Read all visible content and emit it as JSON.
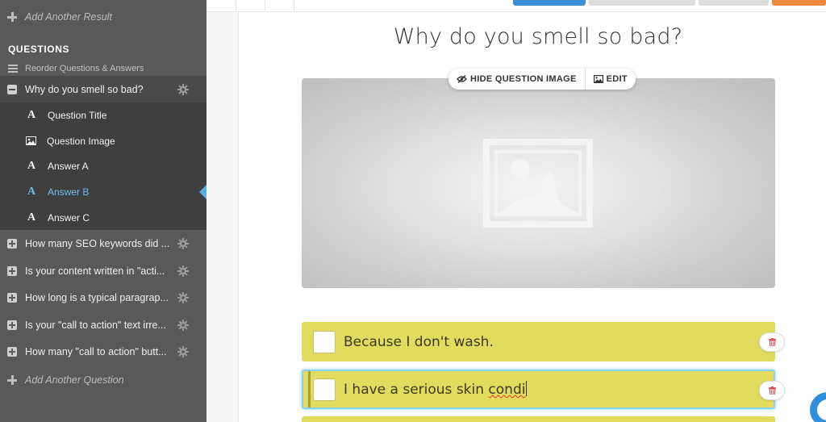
{
  "sidebar": {
    "add_result": "Add Another Result",
    "section_title": "QUESTIONS",
    "reorder": "Reorder Questions & Answers",
    "active_question": "Why do you smell so bad?",
    "sub_items": [
      {
        "label": "Question Title",
        "icon": "text-icon"
      },
      {
        "label": "Question Image",
        "icon": "image-icon"
      },
      {
        "label": "Answer A",
        "icon": "text-icon"
      },
      {
        "label": "Answer B",
        "icon": "text-icon"
      },
      {
        "label": "Answer C",
        "icon": "text-icon"
      }
    ],
    "questions": [
      "How many SEO keywords did ...",
      "Is your content written in \"acti...",
      "How long is a typical paragrap...",
      "Is your \"call to action\" text irre...",
      "How many \"call to action\" butt..."
    ],
    "add_question": "Add Another Question"
  },
  "main": {
    "question_title": "Why do you smell so bad?",
    "toolbar": {
      "hide_image": "HIDE QUESTION IMAGE",
      "edit": "EDIT"
    },
    "answers": {
      "a": "Because I don't wash.",
      "b_prefix": "I have a serious skin ",
      "b_misspelled": "condi"
    }
  },
  "colors": {
    "sidebar_bg": "#595959",
    "active_accent": "#6cc1ef",
    "answer_bg": "#e1db5e",
    "primary_button": "#3c8fd6",
    "orange_button": "#f0883e"
  }
}
